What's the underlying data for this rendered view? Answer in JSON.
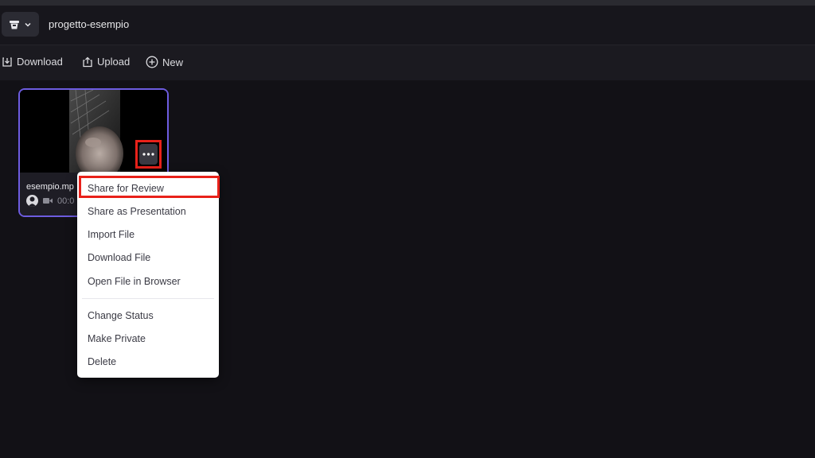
{
  "header": {
    "workspace_icon": "bucket-icon",
    "dropdown_icon": "chevron-down-icon",
    "project_name": "progetto-esempio"
  },
  "toolbar": {
    "download_label": "Download",
    "upload_label": "Upload",
    "new_label": "New"
  },
  "asset_card": {
    "file_name": "esempio.mp",
    "duration": "00:0",
    "more_icon": "ellipsis-icon"
  },
  "context_menu": {
    "items": [
      {
        "label": "Share for Review"
      },
      {
        "label": "Share as Presentation"
      },
      {
        "label": "Import File"
      },
      {
        "label": "Download File"
      },
      {
        "label": "Open File in Browser"
      },
      {
        "label": "Change Status"
      },
      {
        "label": "Make Private"
      },
      {
        "label": "Delete"
      }
    ]
  },
  "colors": {
    "accent": "#6d5ce0",
    "highlight": "#e8211a",
    "background": "#121116"
  }
}
